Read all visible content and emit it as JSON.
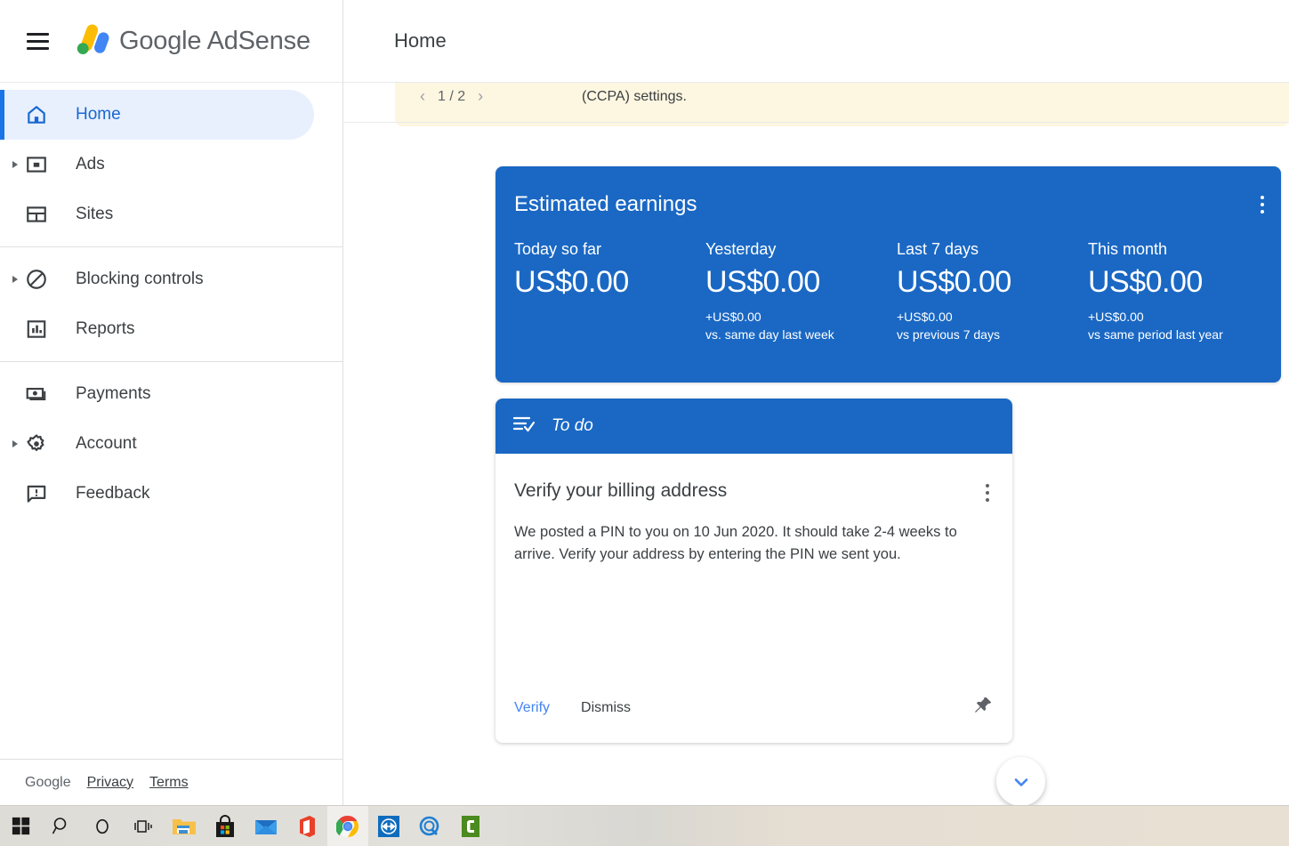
{
  "header": {
    "menu_icon": "hamburger-menu-icon",
    "brand_google": "Google",
    "brand_product": "AdSense",
    "page_title": "Home"
  },
  "sidebar": {
    "groups": [
      {
        "items": [
          {
            "label": "Home",
            "icon": "home-icon",
            "active": true,
            "expandable": false
          },
          {
            "label": "Ads",
            "icon": "ads-icon",
            "active": false,
            "expandable": true
          },
          {
            "label": "Sites",
            "icon": "sites-icon",
            "active": false,
            "expandable": false
          }
        ]
      },
      {
        "items": [
          {
            "label": "Blocking controls",
            "icon": "block-icon",
            "active": false,
            "expandable": true
          },
          {
            "label": "Reports",
            "icon": "reports-icon",
            "active": false,
            "expandable": false
          }
        ]
      },
      {
        "items": [
          {
            "label": "Payments",
            "icon": "payments-icon",
            "active": false,
            "expandable": false
          },
          {
            "label": "Account",
            "icon": "gear-icon",
            "active": false,
            "expandable": true
          },
          {
            "label": "Feedback",
            "icon": "feedback-icon",
            "active": false,
            "expandable": false
          }
        ]
      }
    ],
    "footer": {
      "google": "Google",
      "privacy": "Privacy",
      "terms": "Terms"
    }
  },
  "banner": {
    "pager": "1 / 2",
    "prev_icon": "chevron-left-icon",
    "next_icon": "chevron-right-icon",
    "text": "(CCPA) settings.",
    "background_color": "#fdf6e0"
  },
  "earnings": {
    "title": "Estimated earnings",
    "menu_icon": "more-vert-icon",
    "card_color": "#1a68c4",
    "metrics": [
      {
        "label": "Today so far",
        "value": "US$0.00",
        "delta": "",
        "delta_note": ""
      },
      {
        "label": "Yesterday",
        "value": "US$0.00",
        "delta": "+US$0.00",
        "delta_note": "vs. same day last week"
      },
      {
        "label": "Last 7 days",
        "value": "US$0.00",
        "delta": "+US$0.00",
        "delta_note": "vs previous 7 days"
      },
      {
        "label": "This month",
        "value": "US$0.00",
        "delta": "+US$0.00",
        "delta_note": "vs same period last year"
      }
    ]
  },
  "todo": {
    "header_title": "To do",
    "header_icon": "checklist-icon",
    "item_title": "Verify your billing address",
    "item_menu_icon": "more-vert-icon",
    "item_description": "We posted a PIN to you on 10 Jun 2020. It should take 2-4 weeks to arrive. Verify your address by entering the PIN we sent you.",
    "verify_label": "Verify",
    "dismiss_label": "Dismiss",
    "pin_icon": "pin-icon",
    "verify_color": "#4285f4"
  },
  "scroll_fab": {
    "icon": "chevron-down-icon",
    "color": "#4285f4"
  },
  "taskbar": {
    "items": [
      {
        "name": "start-button",
        "icon": "windows-logo-icon"
      },
      {
        "name": "search-button",
        "icon": "search-icon"
      },
      {
        "name": "cortana-button",
        "icon": "cortana-circle-icon"
      },
      {
        "name": "task-view-button",
        "icon": "task-view-icon"
      },
      {
        "name": "file-explorer-button",
        "icon": "folder-icon"
      },
      {
        "name": "microsoft-store-button",
        "icon": "store-bag-icon"
      },
      {
        "name": "mail-button",
        "icon": "mail-envelope-icon"
      },
      {
        "name": "office-button",
        "icon": "office-icon"
      },
      {
        "name": "chrome-button",
        "icon": "chrome-icon"
      },
      {
        "name": "teamviewer-button",
        "icon": "teamviewer-icon"
      },
      {
        "name": "quicktime-button",
        "icon": "quicktime-icon"
      },
      {
        "name": "camtasia-button",
        "icon": "camtasia-icon"
      }
    ]
  }
}
